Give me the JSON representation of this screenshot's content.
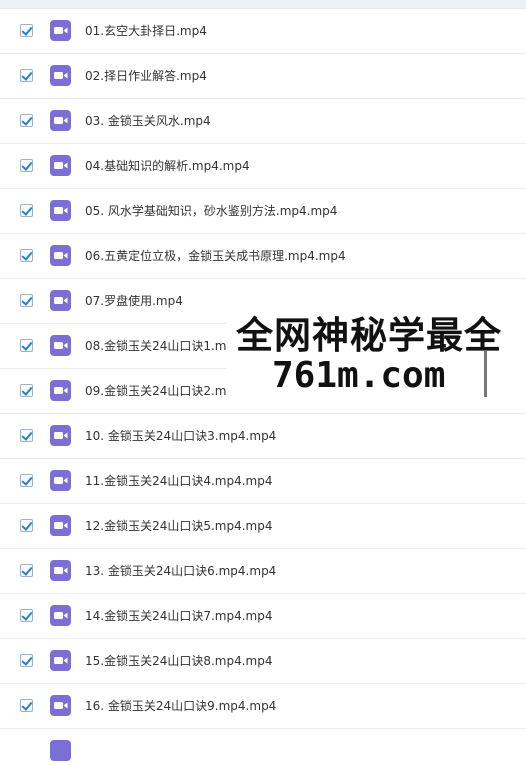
{
  "colors": {
    "checkbox_tick": "#2a7fc9",
    "video_icon": "#7b6fd6",
    "row_divider": "#e9ecef",
    "text": "#333333"
  },
  "files": [
    {
      "name": "01.玄空大卦择日.mp4",
      "checked": true,
      "icon": "video-file-icon"
    },
    {
      "name": "02.择日作业解答.mp4",
      "checked": true,
      "icon": "video-file-icon"
    },
    {
      "name": "03. 金锁玉关风水.mp4",
      "checked": true,
      "icon": "video-file-icon"
    },
    {
      "name": "04.基础知识的解析.mp4.mp4",
      "checked": true,
      "icon": "video-file-icon"
    },
    {
      "name": "05. 风水学基础知识，砂水鉴别方法.mp4.mp4",
      "checked": true,
      "icon": "video-file-icon"
    },
    {
      "name": "06.五黄定位立极，金锁玉关成书原理.mp4.mp4",
      "checked": true,
      "icon": "video-file-icon"
    },
    {
      "name": "07.罗盘使用.mp4",
      "checked": true,
      "icon": "video-file-icon"
    },
    {
      "name": "08.金锁玉关24山口诀1.mp4",
      "checked": true,
      "icon": "video-file-icon"
    },
    {
      "name": "09.金锁玉关24山口诀2.mp4",
      "checked": true,
      "icon": "video-file-icon"
    },
    {
      "name": "10. 金锁玉关24山口诀3.mp4.mp4",
      "checked": true,
      "icon": "video-file-icon"
    },
    {
      "name": "11.金锁玉关24山口诀4.mp4.mp4",
      "checked": true,
      "icon": "video-file-icon"
    },
    {
      "name": "12.金锁玉关24山口诀5.mp4.mp4",
      "checked": true,
      "icon": "video-file-icon"
    },
    {
      "name": "13. 金锁玉关24山口诀6.mp4.mp4",
      "checked": true,
      "icon": "video-file-icon"
    },
    {
      "name": "14.金锁玉关24山口诀7.mp4.mp4",
      "checked": true,
      "icon": "video-file-icon"
    },
    {
      "name": "15.金锁玉关24山口诀8.mp4.mp4",
      "checked": true,
      "icon": "video-file-icon"
    },
    {
      "name": "16. 金锁玉关24山口诀9.mp4.mp4",
      "checked": true,
      "icon": "video-file-icon"
    }
  ],
  "watermark": {
    "line1": "全网神秘学最全",
    "line2": "761m.com"
  }
}
